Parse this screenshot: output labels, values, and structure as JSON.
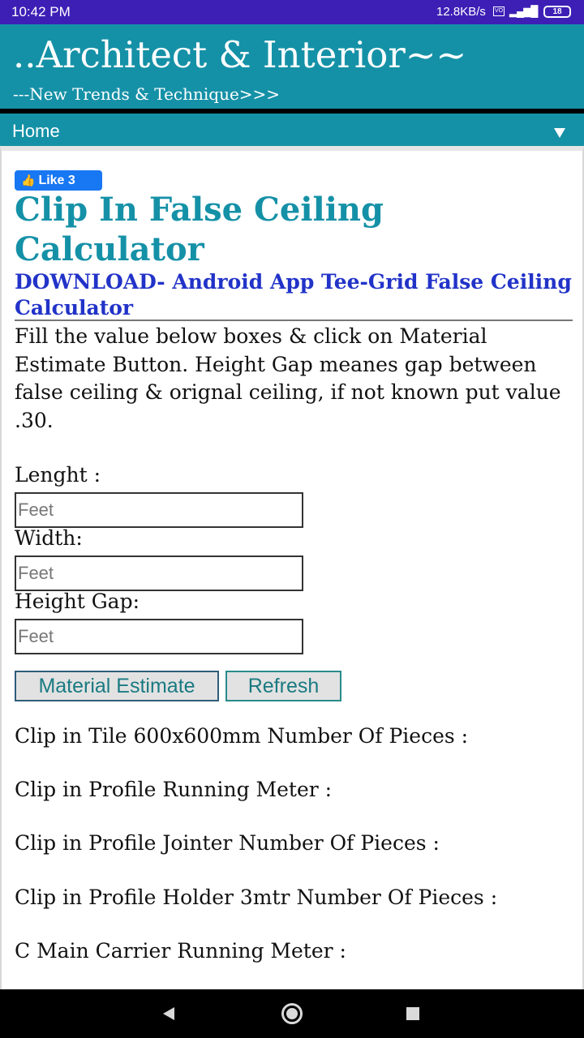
{
  "status_bar": {
    "time": "10:42 PM",
    "network_speed": "12.8KB/s",
    "vo_badge": "Vo LTE",
    "signal": "4G",
    "battery": "18"
  },
  "header": {
    "title": "..Architect & Interior~~",
    "tagline": "---New Trends & Technique>>>"
  },
  "nav": {
    "home_label": "Home"
  },
  "like": {
    "label": "Like 3"
  },
  "page": {
    "title": "Clip In False Ceiling Calculator",
    "download_link": "DOWNLOAD- Android App Tee-Grid False Ceiling Calculator",
    "intro": "Fill the value below boxes & click on Material Estimate Button. Height Gap meanes gap between false ceiling & orignal ceiling, if not known put value .30."
  },
  "form": {
    "length_label": "Lenght :",
    "length_placeholder": "Feet",
    "width_label": "Width:",
    "width_placeholder": "Feet",
    "height_label": "Height Gap:",
    "height_placeholder": "Feet",
    "estimate_button": "Material Estimate",
    "refresh_button": "Refresh"
  },
  "results": [
    "Clip in Tile 600x600mm Number Of Pieces :",
    "Clip in Profile Running Meter :",
    "Clip in Profile Jointer Number Of Pieces :",
    "Clip in Profile Holder 3mtr Number Of Pieces :",
    "C Main Carrier Running Meter :"
  ]
}
